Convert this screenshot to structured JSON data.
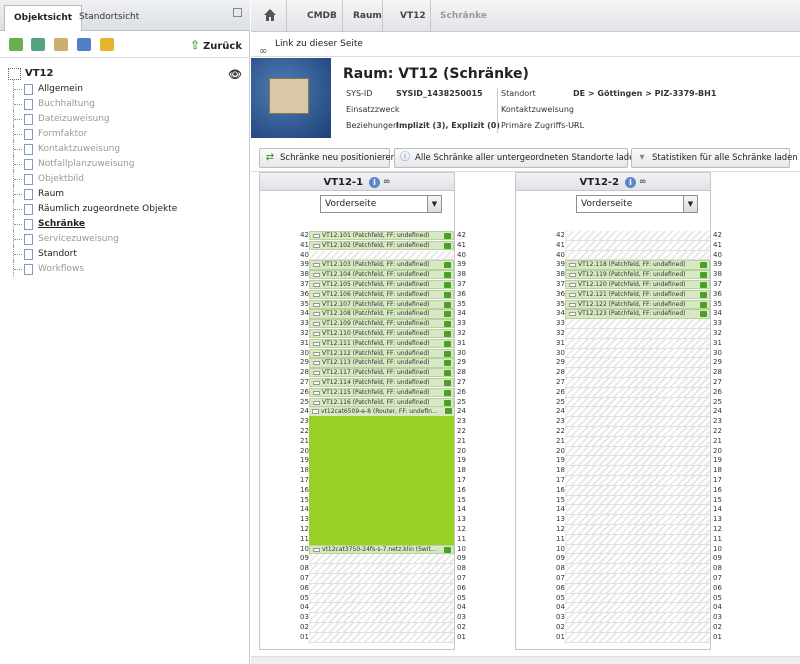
{
  "left": {
    "tabs": {
      "active": "Objektsicht",
      "other": "Standortsicht"
    },
    "back_label": "Zurück",
    "tree": {
      "root": "VT12",
      "items": [
        {
          "label": "Allgemein",
          "state": "normal"
        },
        {
          "label": "Buchhaltung",
          "state": "disabled"
        },
        {
          "label": "Dateizuweisung",
          "state": "disabled"
        },
        {
          "label": "Formfaktor",
          "state": "disabled"
        },
        {
          "label": "Kontaktzuweisung",
          "state": "disabled"
        },
        {
          "label": "Notfallplanzuweisung",
          "state": "disabled"
        },
        {
          "label": "Objektbild",
          "state": "disabled"
        },
        {
          "label": "Raum",
          "state": "normal"
        },
        {
          "label": "Räumlich zugeordnete Objekte",
          "state": "normal"
        },
        {
          "label": "Schränke",
          "state": "current"
        },
        {
          "label": "Servicezuweisung",
          "state": "disabled"
        },
        {
          "label": "Standort",
          "state": "normal"
        },
        {
          "label": "Workflows",
          "state": "disabled"
        }
      ]
    }
  },
  "breadcrumb": {
    "cmdb": "CMDB",
    "raum": "Raum",
    "vt12": "VT12",
    "current": "Schränke"
  },
  "link_label": "Link zu dieser Seite",
  "header": {
    "title": "Raum: VT12 (Schränke)",
    "sysid_label": "SYS-ID",
    "sysid_value": "SYSID_1438250015",
    "einsatz_label": "Einsatzzweck",
    "bez_label": "Beziehungen",
    "bez_value": "Implizit (3), Explizit (0)",
    "standort_label": "Standort",
    "standort_value": "DE > Göttingen > PIZ-3379-BH1",
    "kontakt_label": "Kontaktzuweisung",
    "url_label": "Primäre Zugriffs-URL",
    "url_value": "-"
  },
  "actions": {
    "reposition": "Schränke neu positionieren",
    "load_all": "Alle Schränke aller untergeordneten Standorte laden!",
    "stats": "Statistiken für alle Schränke laden"
  },
  "racks": [
    {
      "name": "VT12-1",
      "view": "Vorderseite",
      "devices": [
        {
          "u": 42,
          "label": "VT12.101 (Patchfeld, FF: undefined)"
        },
        {
          "u": 41,
          "label": "VT12.102 (Patchfeld, FF: undefined)"
        },
        {
          "u": 39,
          "label": "VT12.103 (Patchfeld, FF: undefined)"
        },
        {
          "u": 38,
          "label": "VT12.104 (Patchfeld, FF: undefined)"
        },
        {
          "u": 37,
          "label": "VT12.105 (Patchfeld, FF: undefined)"
        },
        {
          "u": 36,
          "label": "VT12.106 (Patchfeld, FF: undefined)"
        },
        {
          "u": 35,
          "label": "VT12.107 (Patchfeld, FF: undefined)"
        },
        {
          "u": 34,
          "label": "VT12.108 (Patchfeld, FF: undefined)"
        },
        {
          "u": 33,
          "label": "VT12.109 (Patchfeld, FF: undefined)"
        },
        {
          "u": 32,
          "label": "VT12.110 (Patchfeld, FF: undefined)"
        },
        {
          "u": 31,
          "label": "VT12.111 (Patchfeld, FF: undefined)"
        },
        {
          "u": 30,
          "label": "VT12.112 (Patchfeld, FF: undefined)"
        },
        {
          "u": 29,
          "label": "VT12.113 (Patchfeld, FF: undefined)"
        },
        {
          "u": 28,
          "label": "VT12.117 (Patchfeld, FF: undefined)"
        },
        {
          "u": 27,
          "label": "VT12.114 (Patchfeld, FF: undefined)"
        },
        {
          "u": 26,
          "label": "VT12.115 (Patchfeld, FF: undefined)"
        },
        {
          "u": 25,
          "label": "VT12.116 (Patchfeld, FF: undefined)"
        },
        {
          "u": 10,
          "label": "vt12cat3750-24fs-s-7.netz.klin (Swit..."
        }
      ],
      "big_device": {
        "top_u": 24,
        "bottom_u": 11,
        "label": "vt12cat6509-e-8 (Router, FF: undefin..."
      }
    },
    {
      "name": "VT12-2",
      "view": "Vorderseite",
      "devices": [
        {
          "u": 39,
          "label": "VT12.118 (Patchfeld, FF: undefined)"
        },
        {
          "u": 38,
          "label": "VT12.119 (Patchfeld, FF: undefined)"
        },
        {
          "u": 37,
          "label": "VT12.120 (Patchfeld, FF: undefined)"
        },
        {
          "u": 36,
          "label": "VT12.121 (Patchfeld, FF: undefined)"
        },
        {
          "u": 35,
          "label": "VT12.122 (Patchfeld, FF: undefined)"
        },
        {
          "u": 34,
          "label": "VT12.123 (Patchfeld, FF: undefined)"
        }
      ]
    }
  ]
}
